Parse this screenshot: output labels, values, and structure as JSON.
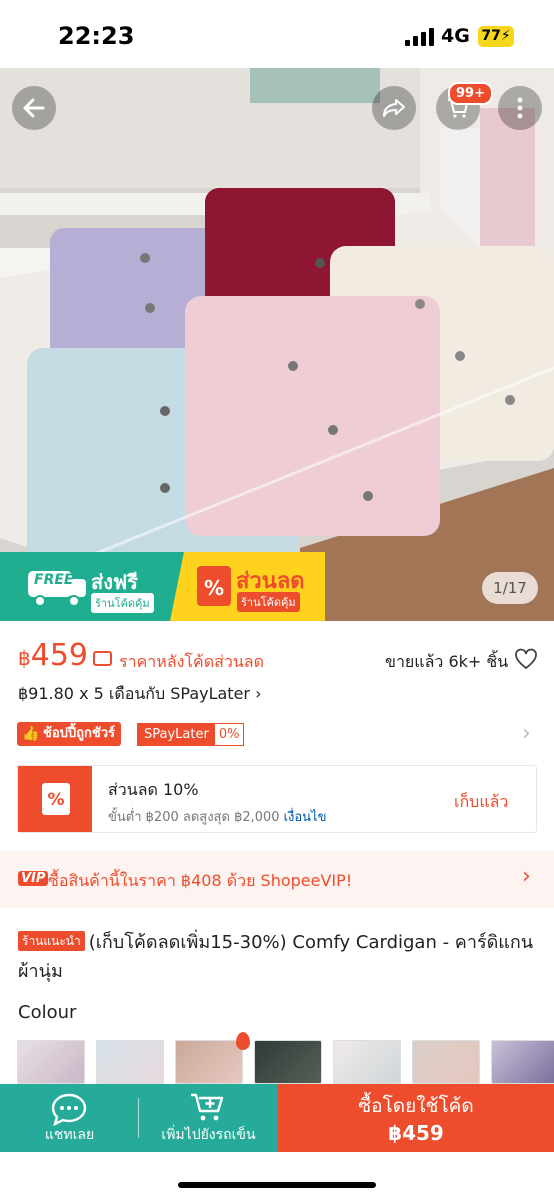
{
  "status_bar": {
    "time": "22:23",
    "network": "4G",
    "battery": "77"
  },
  "hero": {
    "cart_badge": "99+",
    "promo_free": {
      "tag": "FREE",
      "title": "ส่งฟรี",
      "sub": "ร้านโค้ดคุ้ม"
    },
    "promo_sale": {
      "icon": "%",
      "title": "ส่วนลด",
      "sub": "ร้านโค้ดคุ้ม"
    },
    "image_counter": "1/17"
  },
  "price": {
    "currency": "฿",
    "amount": "459",
    "after_code_label": "ราคาหลังโค้ดส่วนลด",
    "sold": "ขายแล้ว 6k+ ชิ้น",
    "installment": "฿91.80 x 5 เดือนกับ SPayLater"
  },
  "tags": {
    "guarantee": "ช้อปปี้ถูกชัวร์",
    "spay": "SPayLater",
    "spay_rate": "0%"
  },
  "voucher": {
    "title": "ส่วนลด 10%",
    "condition": "ขั้นต่ำ ฿200 ลดสูงสุด ฿2,000",
    "condition_link": "เงื่อนไข",
    "action": "เก็บแล้ว"
  },
  "vip": {
    "tag": "VIP",
    "text": "ซื้อสินค้านี้ในราคา ฿408 ด้วย ShopeeVIP!"
  },
  "product": {
    "tag": "ร้านแนะนำ",
    "title": "(เก็บโค้ดลดเพิ่ม15-30%) Comfy Cardigan - คาร์ดิแกน ผ้านุ่ม"
  },
  "colour": {
    "label": "Colour",
    "thumb_count": 7
  },
  "bottom_bar": {
    "chat": "แชทเลย",
    "add_cart": "เพิ่มไปยังรถเข็น",
    "buy_label": "ซื้อโดยใช้โค้ด",
    "buy_price": "฿459"
  },
  "colors": {
    "accent": "#ee4d2d",
    "teal": "#26aa99"
  }
}
